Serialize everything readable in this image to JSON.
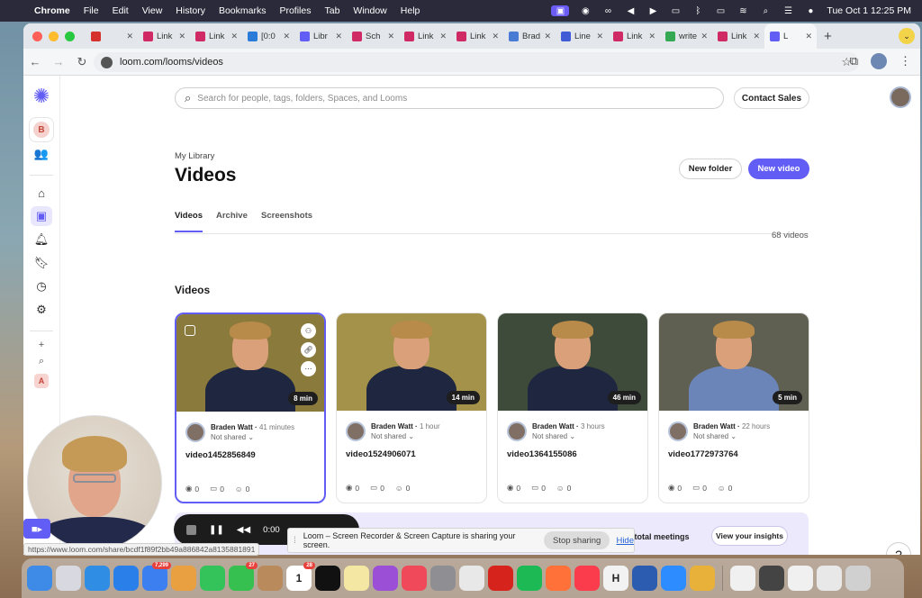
{
  "menubar": {
    "app": "Chrome",
    "items": [
      "File",
      "Edit",
      "View",
      "History",
      "Bookmarks",
      "Profiles",
      "Tab",
      "Window",
      "Help"
    ],
    "datetime": "Tue Oct 1  12:25 PM"
  },
  "tabs": [
    {
      "label": "",
      "icon": "loom-record-icon",
      "color": "#d6322d"
    },
    {
      "label": "Link",
      "icon": "sk-icon",
      "color": "#d02a64"
    },
    {
      "label": "Link",
      "icon": "sk-icon",
      "color": "#d02a64"
    },
    {
      "label": "[0:0",
      "icon": "t-icon",
      "color": "#2b7bd9"
    },
    {
      "label": "Libr",
      "icon": "loom-icon",
      "color": "#625df5"
    },
    {
      "label": "Sch",
      "icon": "sk-icon",
      "color": "#d02a64"
    },
    {
      "label": "Link",
      "icon": "sk-icon",
      "color": "#d02a64"
    },
    {
      "label": "Link",
      "icon": "sk-icon",
      "color": "#d02a64"
    },
    {
      "label": "Brad",
      "icon": "calendar-icon",
      "color": "#4a7bd4"
    },
    {
      "label": "Line",
      "icon": "shield-icon",
      "color": "#3f5bd6"
    },
    {
      "label": "Link",
      "icon": "sk-icon",
      "color": "#d02a64"
    },
    {
      "label": "write",
      "icon": "google-icon",
      "color": "#34a853"
    },
    {
      "label": "Link",
      "icon": "sk-icon",
      "color": "#d02a64"
    },
    {
      "label": "L",
      "icon": "loom-icon",
      "color": "#625df5",
      "active": true
    }
  ],
  "url": "loom.com/looms/videos",
  "search": {
    "placeholder": "Search for people, tags, folders, Spaces, and Looms"
  },
  "contact_sales": "Contact Sales",
  "sidebar": {
    "workspace_initial": "B",
    "bottom_initial": "A"
  },
  "breadcrumb": "My Library",
  "page_title": "Videos",
  "buttons": {
    "new_folder": "New folder",
    "new_video": "New video"
  },
  "page_tabs": [
    {
      "label": "Videos",
      "selected": true
    },
    {
      "label": "Archive"
    },
    {
      "label": "Screenshots"
    }
  ],
  "video_count": "68 videos",
  "section_title": "Videos",
  "videos": [
    {
      "title": "video1452856849",
      "author": "Braden Watt",
      "age": "41 minutes",
      "shared": "Not shared",
      "duration": "8 min",
      "views": "0",
      "comments": "0",
      "reactions": "0",
      "bg": "#8a7a3c",
      "selected": true
    },
    {
      "title": "video1524906071",
      "author": "Braden Watt",
      "age": "1 hour",
      "shared": "Not shared",
      "duration": "14 min",
      "views": "0",
      "comments": "0",
      "reactions": "0",
      "bg": "#a4914a"
    },
    {
      "title": "video1364155086",
      "author": "Braden Watt",
      "age": "3 hours",
      "shared": "Not shared",
      "duration": "46 min",
      "views": "0",
      "comments": "0",
      "reactions": "0",
      "bg": "#3e4a3a"
    },
    {
      "title": "video1772973764",
      "author": "Braden Watt",
      "age": "22 hours",
      "shared": "Not shared",
      "duration": "5 min",
      "views": "0",
      "comments": "0",
      "reactions": "0",
      "bg": "#5f5f52",
      "shirt": "#6b85b8"
    }
  ],
  "banner": {
    "meetings": "7 total meetings",
    "insights_button": "View your insights"
  },
  "recording": {
    "time": "0:00"
  },
  "status_url": "https://www.loom.com/share/bcdf1f89f2bb49a886842a8135881891",
  "sharebar": {
    "message": "Loom – Screen Recorder & Screen Capture is sharing your screen.",
    "stop": "Stop sharing",
    "hide": "Hide"
  },
  "help": "?",
  "dock": [
    {
      "name": "finder-icon",
      "color": "#3d8be6"
    },
    {
      "name": "launchpad-icon",
      "color": "#d8d8e0"
    },
    {
      "name": "safari-icon",
      "color": "#2f8de4"
    },
    {
      "name": "appstore-icon",
      "color": "#2b7fe8"
    },
    {
      "name": "mail-icon",
      "color": "#3b7ff0",
      "badge": "7,299"
    },
    {
      "name": "photos-icon",
      "color": "#e8a040"
    },
    {
      "name": "facetime-icon",
      "color": "#34c35a"
    },
    {
      "name": "messages-icon",
      "color": "#35c04f",
      "badge": "27"
    },
    {
      "name": "contacts-icon",
      "color": "#b88a5c"
    },
    {
      "name": "calendar-icon",
      "color": "#ffffff",
      "text": "1",
      "badge": "28"
    },
    {
      "name": "appletv-icon",
      "color": "#111111"
    },
    {
      "name": "notes-icon",
      "color": "#f4e7a3"
    },
    {
      "name": "podcasts-icon",
      "color": "#9b4fd6"
    },
    {
      "name": "news-icon",
      "color": "#f04a5a"
    },
    {
      "name": "settings-icon",
      "color": "#8e8e93"
    },
    {
      "name": "pen-icon",
      "color": "#e8e8e8"
    },
    {
      "name": "acrobat-icon",
      "color": "#d6241c"
    },
    {
      "name": "spotify-icon",
      "color": "#1db954"
    },
    {
      "name": "firefox-icon",
      "color": "#ff7139"
    },
    {
      "name": "music-icon",
      "color": "#fa3c4c"
    },
    {
      "name": "hemingway-icon",
      "color": "#f2f2f2",
      "text": "H"
    },
    {
      "name": "word-icon",
      "color": "#2b5cb0"
    },
    {
      "name": "zoom-icon",
      "color": "#2d8cff"
    },
    {
      "name": "chrome-icon",
      "color": "#e8b23a"
    },
    {
      "name": "screenshot1-icon",
      "color": "#f0f0f0"
    },
    {
      "name": "screenshot2-icon",
      "color": "#444444"
    },
    {
      "name": "screenshot3-icon",
      "color": "#f0f0f0"
    },
    {
      "name": "screenshot4-icon",
      "color": "#e8e8e8"
    },
    {
      "name": "trash-icon",
      "color": "#d0d0d0"
    }
  ]
}
